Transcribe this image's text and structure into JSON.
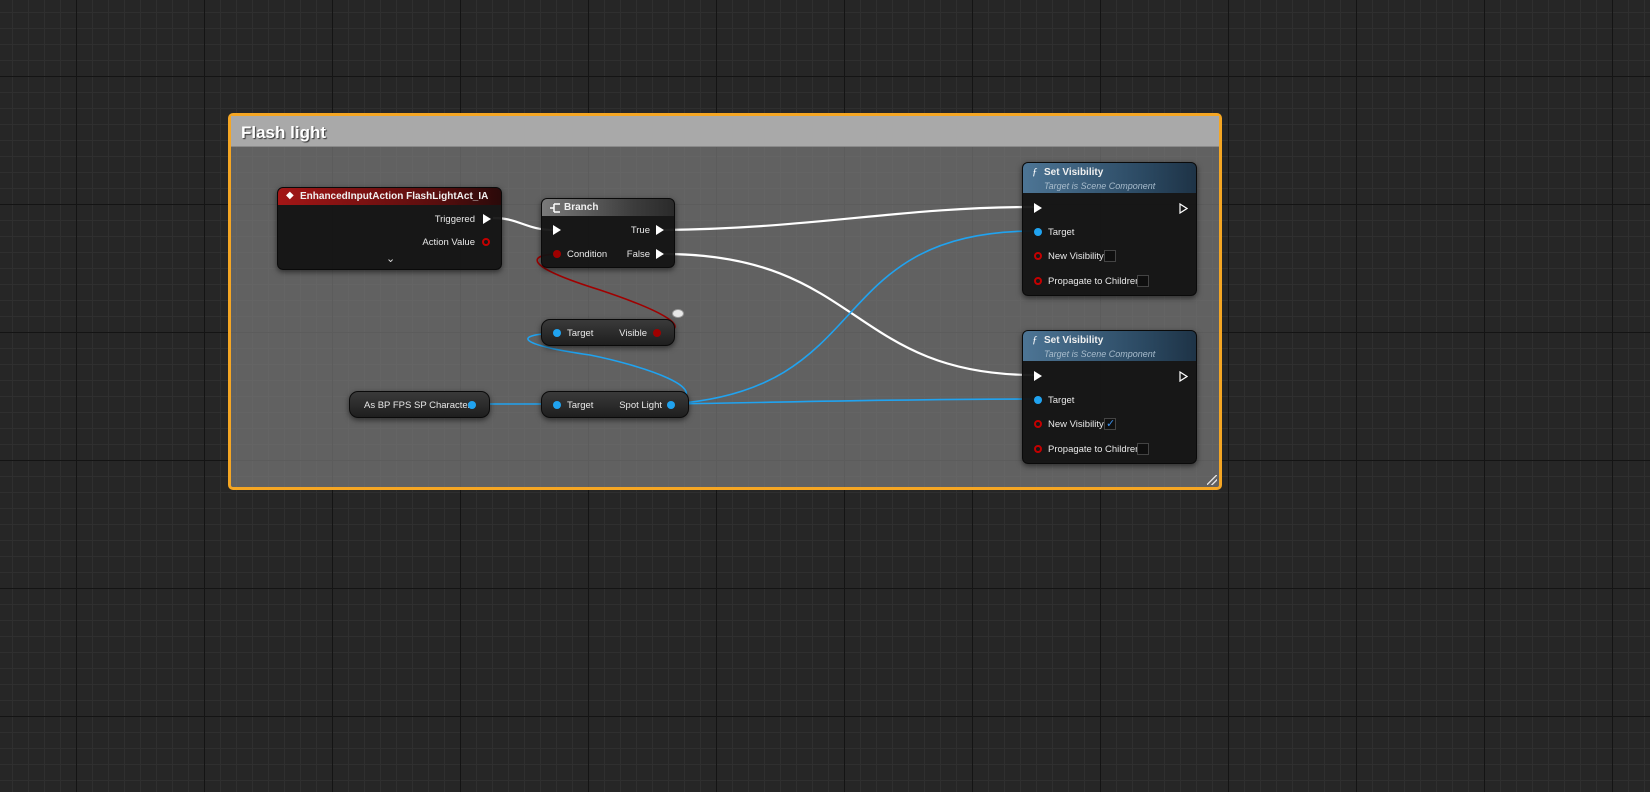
{
  "comment": {
    "title": "Flash light"
  },
  "event_node": {
    "title": "EnhancedInputAction FlashLightAct_IA",
    "pins": {
      "triggered": "Triggered",
      "action_value": "Action Value"
    },
    "expand_icon": "chevron-down-icon"
  },
  "branch_node": {
    "title": "Branch",
    "pins": {
      "condition": "Condition",
      "true": "True",
      "false": "False"
    }
  },
  "get_visible_node": {
    "pins": {
      "target": "Target",
      "visible": "Visible"
    }
  },
  "cast_node": {
    "label": "As BP FPS SP Character"
  },
  "get_spotlight_node": {
    "pins": {
      "target": "Target",
      "spot_light": "Spot Light"
    }
  },
  "set_visibility_top": {
    "title": "Set Visibility",
    "subtitle": "Target is Scene Component",
    "pins": {
      "target": "Target",
      "new_visibility": "New Visibility",
      "propagate": "Propagate to Children"
    },
    "new_visibility_checked": false,
    "propagate_checked": false
  },
  "set_visibility_bottom": {
    "title": "Set Visibility",
    "subtitle": "Target is Scene Component",
    "pins": {
      "target": "Target",
      "new_visibility": "New Visibility",
      "propagate": "Propagate to Children"
    },
    "new_visibility_checked": true,
    "propagate_checked": false
  },
  "colors": {
    "comment_border": "#f5a623",
    "exec_wire": "#ffffff",
    "object_wire": "#20a3f0",
    "bool_wire": "#a00000",
    "event_header": "#a31616",
    "function_header": "#4d7595"
  }
}
